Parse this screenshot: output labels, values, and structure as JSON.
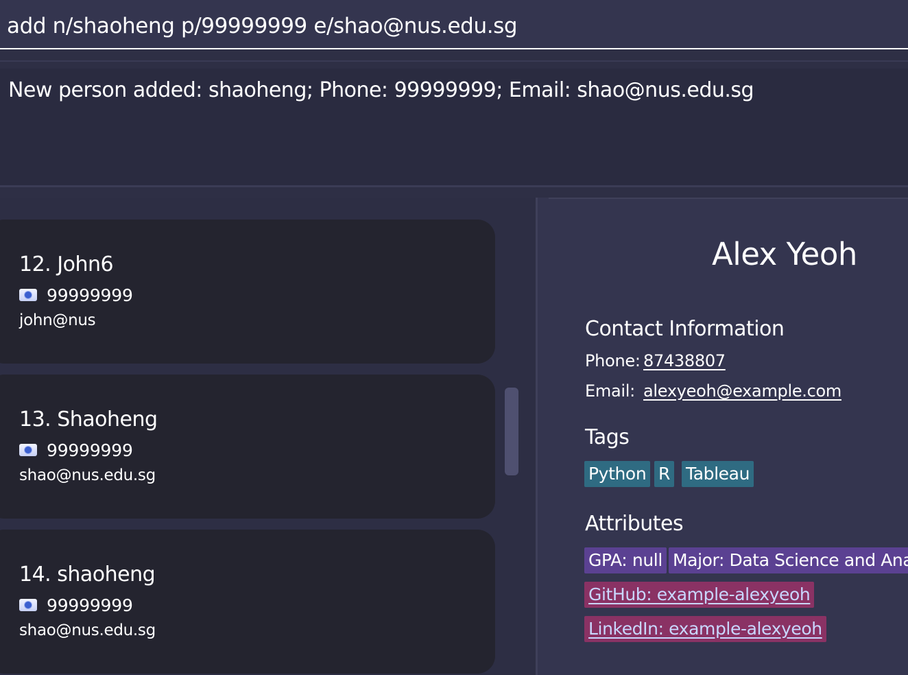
{
  "command_box": {
    "value": "add n/shaoheng p/99999999 e/shao@nus.edu.sg"
  },
  "result_display": {
    "text": "New person added: shaoheng; Phone: 99999999; Email: shao@nus.edu.sg"
  },
  "person_list": {
    "items": [
      {
        "name": "12. John6",
        "phone": "99999999",
        "email": "john@nus",
        "phone_icon": "phone-card-icon"
      },
      {
        "name": "13. Shaoheng",
        "phone": "99999999",
        "email": "shao@nus.edu.sg",
        "phone_icon": "phone-card-icon"
      },
      {
        "name": "14. shaoheng",
        "phone": "99999999",
        "email": "shao@nus.edu.sg",
        "phone_icon": "phone-card-icon"
      }
    ]
  },
  "detail": {
    "name": "Alex Yeoh",
    "contact_heading": "Contact Information",
    "phone_label": "Phone:",
    "phone_value": "87438807",
    "email_label": "Email:",
    "email_value": "alexyeoh@example.com",
    "tags_heading": "Tags",
    "tags": [
      "Python",
      "R",
      "Tableau"
    ],
    "attributes_heading": "Attributes",
    "attributes": [
      "GPA: null",
      "Major: Data Science and Analytics"
    ],
    "links": [
      "GitHub: example-alexyeoh",
      "LinkedIn: example-alexyeoh"
    ]
  },
  "colors": {
    "background": "#2e2f45",
    "card": "#24242f",
    "detail_panel": "#34354f",
    "tag_chip": "#2f6b82",
    "attribute_chip": "#5b4192",
    "link_chip": "#8a3264",
    "link_text": "#c9d7ff"
  }
}
